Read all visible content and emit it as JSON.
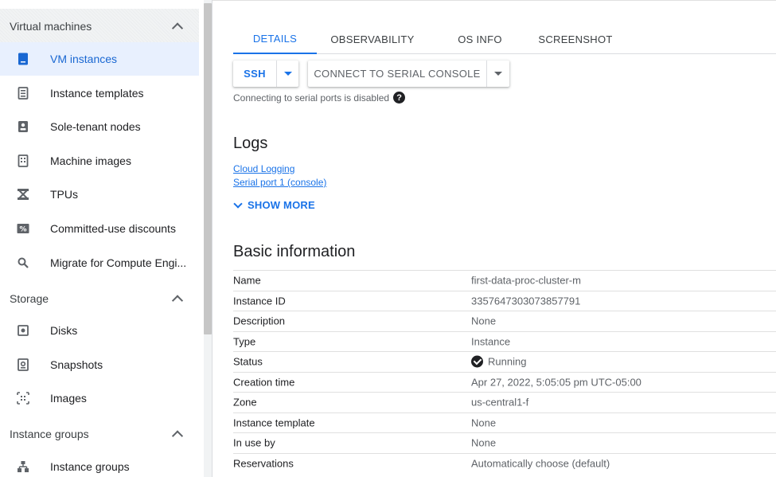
{
  "sidebar": {
    "sections": [
      {
        "title": "Virtual machines",
        "items": [
          {
            "label": "VM instances",
            "icon": "vm-instance-icon"
          },
          {
            "label": "Instance templates",
            "icon": "template-icon"
          },
          {
            "label": "Sole-tenant nodes",
            "icon": "sole-tenant-icon"
          },
          {
            "label": "Machine images",
            "icon": "machine-image-icon"
          },
          {
            "label": "TPUs",
            "icon": "tpu-icon"
          },
          {
            "label": "Committed-use discounts",
            "icon": "discount-icon"
          },
          {
            "label": "Migrate for Compute Engi...",
            "icon": "search-icon"
          }
        ]
      },
      {
        "title": "Storage",
        "items": [
          {
            "label": "Disks",
            "icon": "disk-icon"
          },
          {
            "label": "Snapshots",
            "icon": "snapshot-icon"
          },
          {
            "label": "Images",
            "icon": "image-icon"
          }
        ]
      },
      {
        "title": "Instance groups",
        "items": [
          {
            "label": "Instance groups",
            "icon": "instance-groups-icon"
          }
        ]
      }
    ]
  },
  "tabs": [
    "DETAILS",
    "OBSERVABILITY",
    "OS INFO",
    "SCREENSHOT"
  ],
  "toolbar": {
    "ssh_label": "SSH",
    "serial_label": "CONNECT TO SERIAL CONSOLE",
    "serial_note": "Connecting to serial ports is disabled",
    "help_glyph": "?"
  },
  "logs": {
    "title": "Logs",
    "links": [
      "Cloud Logging",
      "Serial port 1 (console)"
    ],
    "show_more": "SHOW MORE"
  },
  "basic_info": {
    "title": "Basic information",
    "rows": [
      {
        "key": "Name",
        "value": "first-data-proc-cluster-m"
      },
      {
        "key": "Instance ID",
        "value": "3357647303073857791"
      },
      {
        "key": "Description",
        "value": "None"
      },
      {
        "key": "Type",
        "value": "Instance"
      },
      {
        "key": "Status",
        "value": "Running"
      },
      {
        "key": "Creation time",
        "value": "Apr 27, 2022, 5:05:05 pm UTC-05:00"
      },
      {
        "key": "Zone",
        "value": "us-central1-f"
      },
      {
        "key": "Instance template",
        "value": "None"
      },
      {
        "key": "In use by",
        "value": "None"
      },
      {
        "key": "Reservations",
        "value": "Automatically choose (default)"
      }
    ]
  },
  "colors": {
    "accent": "#1a73e8",
    "active_bg": "#e8f0fe"
  }
}
